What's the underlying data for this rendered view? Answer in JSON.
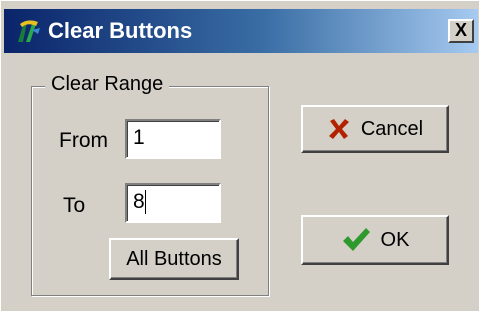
{
  "window": {
    "title": "Clear Buttons",
    "close_glyph": "X",
    "title_icon": "app-icon"
  },
  "group": {
    "label": "Clear Range",
    "from_label": "From",
    "from_value": "1",
    "to_label": "To",
    "to_value": "8",
    "all_buttons_label": "All Buttons"
  },
  "actions": {
    "cancel_label": "Cancel",
    "cancel_icon": "x-cross-icon",
    "cancel_icon_color": "#b22200",
    "ok_label": "OK",
    "ok_icon": "checkmark-icon",
    "ok_icon_color": "#2e9a2e"
  }
}
